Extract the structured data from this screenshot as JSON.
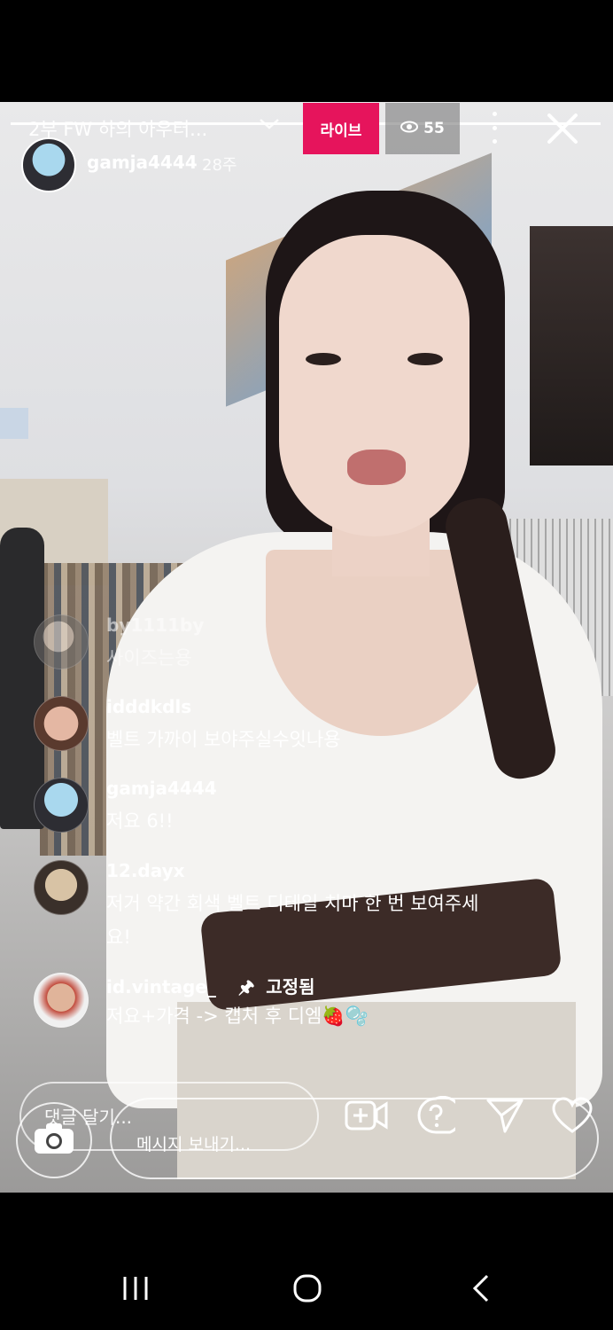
{
  "stream": {
    "title": "2부 FW 하의 아우터...",
    "live_label": "라이브",
    "viewer_count": "55",
    "host": {
      "username": "gamja4444",
      "meta": "28주"
    }
  },
  "comments": [
    {
      "user": "by1111by",
      "text": "사이즈는용"
    },
    {
      "user": "idddkdls",
      "text": "벨트 가까이 보야주실수잇나용"
    },
    {
      "user": "gamja4444",
      "text": "저요 6!!"
    },
    {
      "user": "12.dayx",
      "text": "저거 약간 회색 벨트 디테일 치마 한 번 보여주세요!"
    },
    {
      "user": "id.vintage_",
      "pinned_label": "고정됨",
      "text": "저요+가격 -> 캡처 후 디엠🍓🫧"
    }
  ],
  "composer": {
    "comment_placeholder": "댓글 달기...",
    "message_placeholder": "메시지 보내기..."
  },
  "icons": [
    "eye-icon",
    "more-icon",
    "close-icon",
    "camera-icon",
    "add-video-icon",
    "question-icon",
    "send-icon",
    "heart-icon",
    "recents-icon",
    "home-icon",
    "back-icon"
  ],
  "colors": {
    "live_badge": "#e6145c"
  }
}
